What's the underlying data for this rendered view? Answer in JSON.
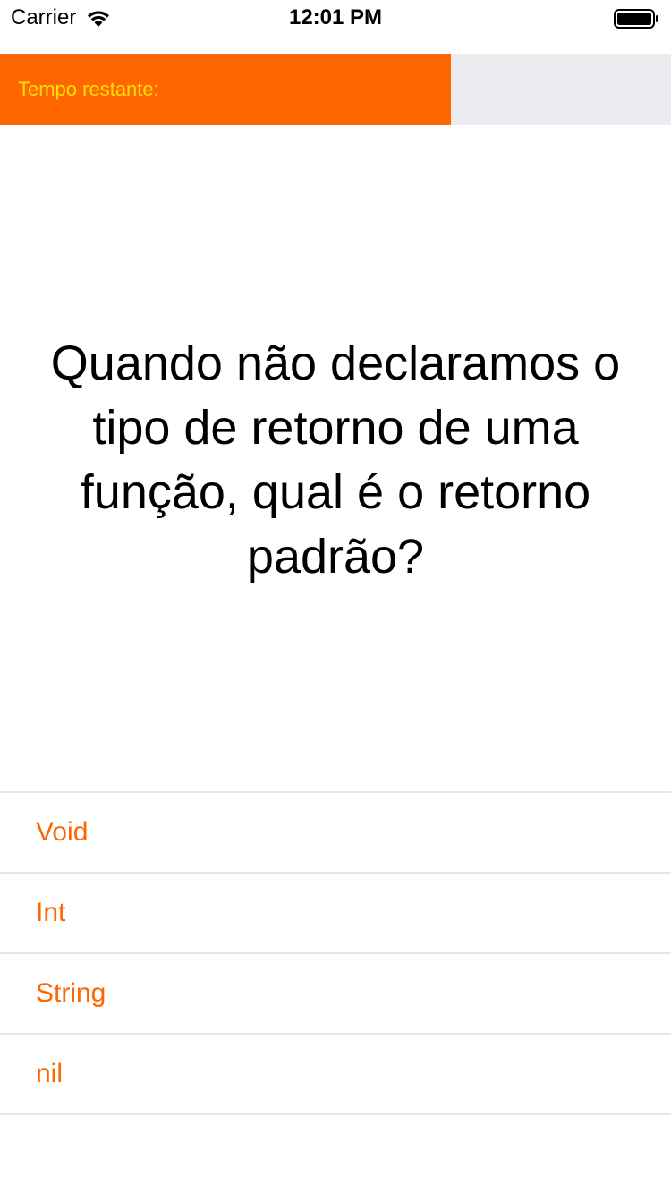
{
  "status_bar": {
    "carrier": "Carrier",
    "time": "12:01 PM",
    "wifi_icon": "wifi-icon",
    "battery_icon": "battery-full-icon"
  },
  "timer": {
    "label": "Tempo restante:",
    "remaining_fraction": 0.672,
    "fill_color": "#ff6600",
    "track_color": "#ebebf0",
    "label_color": "#ffe100"
  },
  "question": {
    "text": "Quando não declaramos o tipo de retorno de uma função, qual é o retorno padrão?"
  },
  "answers": [
    {
      "label": "Void"
    },
    {
      "label": "Int"
    },
    {
      "label": "String"
    },
    {
      "label": "nil"
    }
  ],
  "colors": {
    "accent": "#ff6600",
    "divider": "#e6e6e6"
  }
}
